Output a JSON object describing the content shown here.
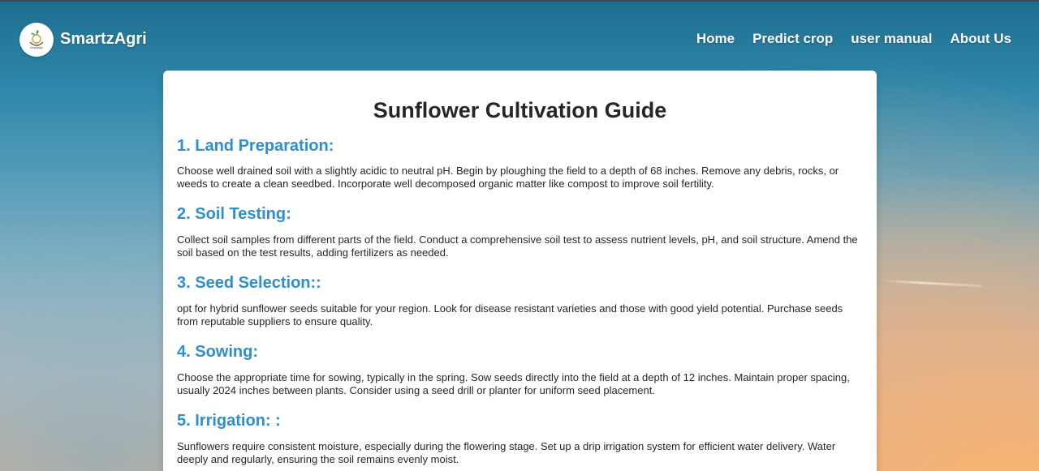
{
  "brand": {
    "name": "SmartzAgri",
    "logo_text": "SmartzAgri"
  },
  "nav": {
    "items": [
      {
        "label": "Home"
      },
      {
        "label": "Predict crop"
      },
      {
        "label": "user manual"
      },
      {
        "label": "About Us"
      }
    ]
  },
  "page": {
    "title": "Sunflower Cultivation Guide"
  },
  "sections": [
    {
      "heading": "1. Land Preparation:",
      "body": "Choose well drained soil with a slightly acidic to neutral pH. Begin by ploughing the field to a depth of 68 inches. Remove any debris, rocks, or weeds to create a clean seedbed. Incorporate well decomposed organic matter like compost to improve soil fertility."
    },
    {
      "heading": "2. Soil Testing:",
      "body": "Collect soil samples from different parts of the field. Conduct a comprehensive soil test to assess nutrient levels, pH, and soil structure. Amend the soil based on the test results, adding fertilizers as needed."
    },
    {
      "heading": "3. Seed Selection::",
      "body": "opt for hybrid sunflower seeds suitable for your region. Look for disease resistant varieties and those with good yield potential. Purchase seeds from reputable suppliers to ensure quality."
    },
    {
      "heading": "4. Sowing:",
      "body": "Choose the appropriate time for sowing, typically in the spring. Sow seeds directly into the field at a depth of 12 inches. Maintain proper spacing, usually 2024 inches between plants. Consider using a seed drill or planter for uniform seed placement."
    },
    {
      "heading": "5. Irrigation: :",
      "body": "Sunflowers require consistent moisture, especially during the flowering stage. Set up a drip irrigation system for efficient water delivery. Water deeply and regularly, ensuring the soil remains evenly moist."
    }
  ],
  "colors": {
    "heading_accent": "#2e8ecf",
    "text": "#262626",
    "card_bg": "#ffffff"
  }
}
